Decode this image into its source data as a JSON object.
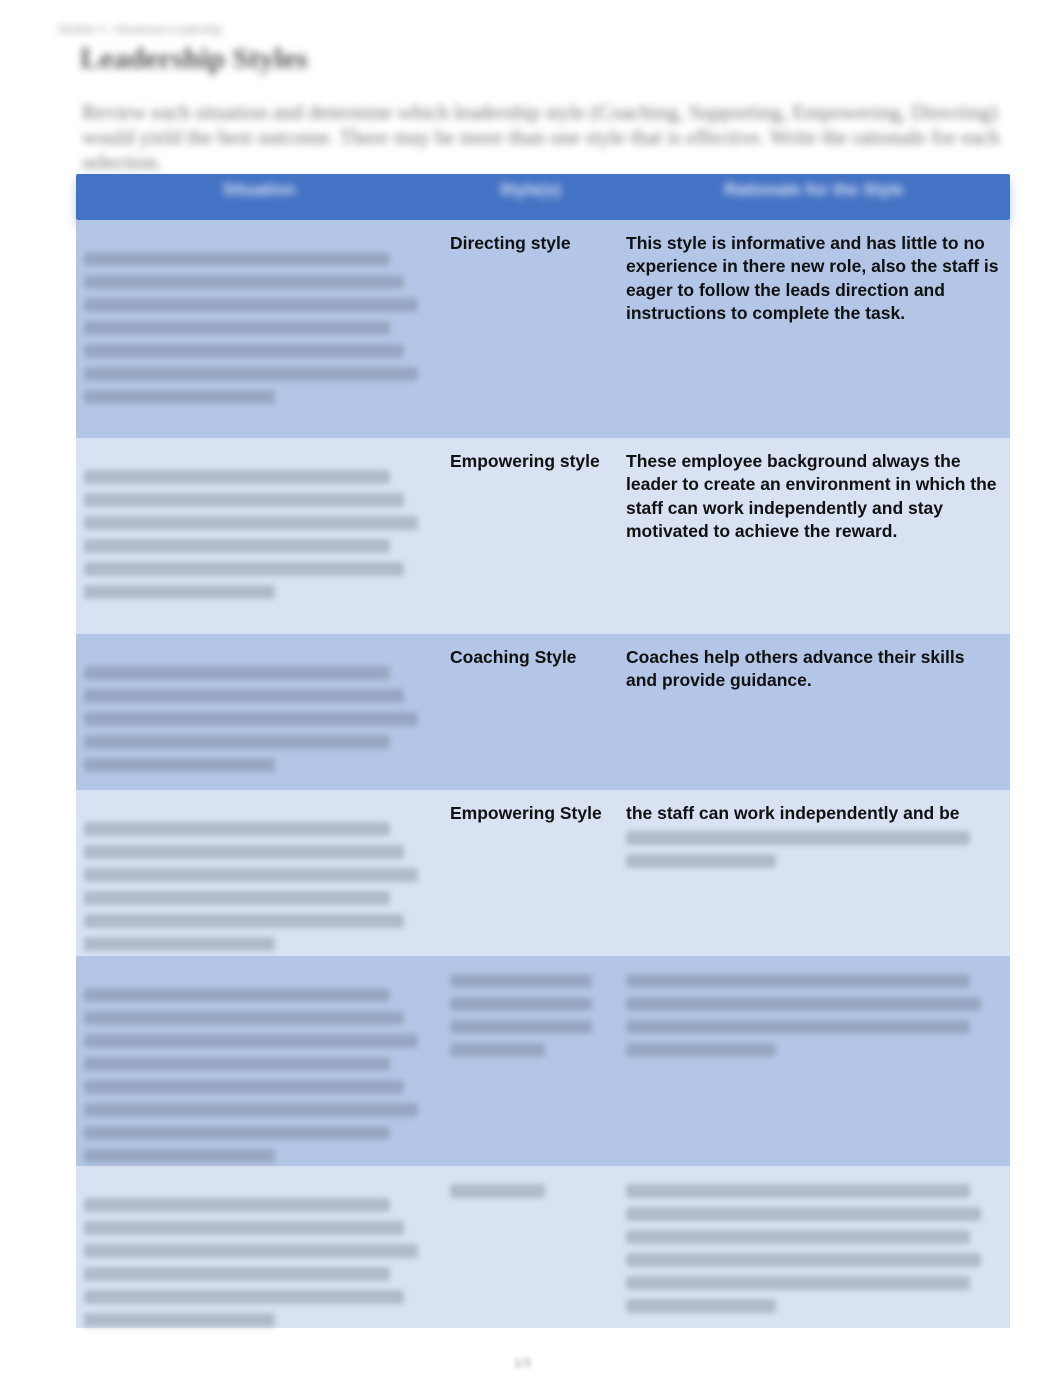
{
  "document": {
    "running_head": "Module 3 - Situational Leadership",
    "title": "Leadership Styles",
    "intro": "Review each situation and determine which leadership style (Coaching, Supporting, Empowering, Directing) would yield the best outcome. There may be more than one style that is effective. Write the rationale for each selection."
  },
  "table": {
    "headers": [
      "Situation",
      "Style(s)",
      "Rationale for the Style"
    ],
    "rows": [
      {
        "shade": "dark",
        "situation_lines": 7,
        "style": "Directing style",
        "rationale": "This style is informative and has little to no experience in there new role, also the staff is eager to follow the leads direction and instructions to complete the task."
      },
      {
        "shade": "light",
        "situation_lines": 6,
        "style": "Empowering style",
        "rationale": "These employee background always the leader to create an environment in which the staff can work independently and stay motivated to achieve the reward."
      },
      {
        "shade": "dark",
        "situation_lines": 5,
        "style": "Coaching Style",
        "rationale": "Coaches help others advance their skills and provide guidance."
      },
      {
        "shade": "light",
        "situation_lines": 6,
        "style": "Empowering Style",
        "rationale": "the staff can work independently and be",
        "rationale_blurred_lines": 2
      },
      {
        "shade": "dark",
        "situation_lines": 8,
        "style": "",
        "style_blurred_lines": 4,
        "rationale": "",
        "rationale_blurred_lines": 4
      },
      {
        "shade": "light",
        "situation_lines": 6,
        "style": "",
        "style_blurred_lines": 1,
        "rationale": "",
        "rationale_blurred_lines": 6
      }
    ]
  },
  "footer": {
    "page_number": "1/3"
  }
}
